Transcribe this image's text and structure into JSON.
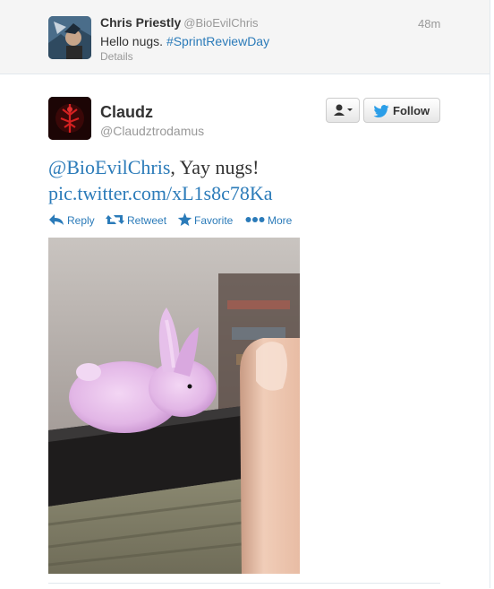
{
  "parent_tweet": {
    "name": "Chris Priestly",
    "handle": "@BioEvilChris",
    "time": "48m",
    "text_prefix": "Hello nugs. ",
    "hashtag": "#SprintReviewDay",
    "details_label": "Details"
  },
  "main_tweet": {
    "name": "Claudz",
    "handle": "@Claudztrodamus",
    "follow_label": "Follow",
    "mention": "@BioEvilChris",
    "text_rest": ", Yay nugs!",
    "link": "pic.twitter.com/xL1s8c78Ka",
    "actions": {
      "reply": "Reply",
      "retweet": "Retweet",
      "favorite": "Favorite",
      "more": "More"
    }
  },
  "colors": {
    "link": "#2b7bb9",
    "muted": "#999999",
    "text": "#333333",
    "parent_bg": "#f5f5f5"
  },
  "icons": [
    "user-dropdown-icon",
    "twitter-bird-icon",
    "reply-icon",
    "retweet-icon",
    "favorite-star-icon",
    "more-dots-icon"
  ]
}
